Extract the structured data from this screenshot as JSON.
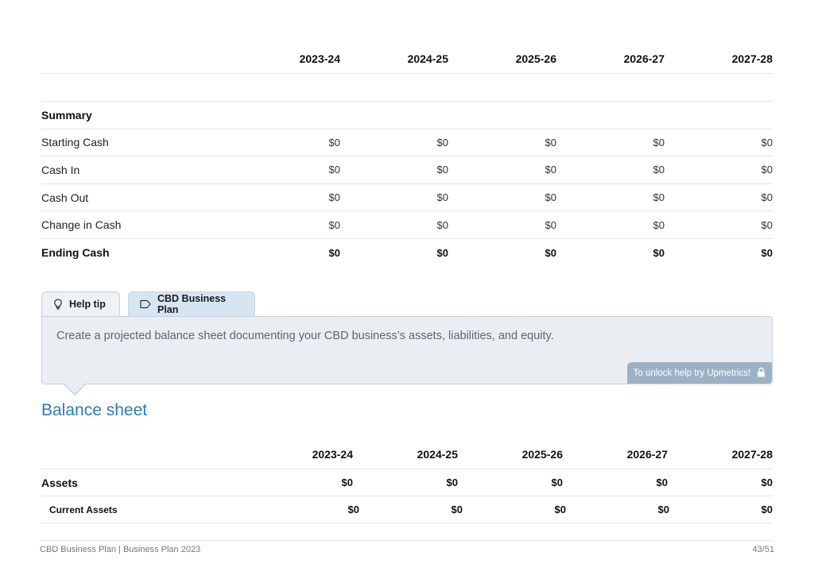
{
  "years": [
    "2023-24",
    "2024-25",
    "2025-26",
    "2026-27",
    "2027-28"
  ],
  "cashflow": {
    "summary_label": "Summary",
    "rows": [
      {
        "label": "Starting Cash",
        "values": [
          "$0",
          "$0",
          "$0",
          "$0",
          "$0"
        ]
      },
      {
        "label": "Cash In",
        "values": [
          "$0",
          "$0",
          "$0",
          "$0",
          "$0"
        ]
      },
      {
        "label": "Cash Out",
        "values": [
          "$0",
          "$0",
          "$0",
          "$0",
          "$0"
        ]
      },
      {
        "label": "Change in Cash",
        "values": [
          "$0",
          "$0",
          "$0",
          "$0",
          "$0"
        ]
      },
      {
        "label": "Ending Cash",
        "values": [
          "$0",
          "$0",
          "$0",
          "$0",
          "$0"
        ]
      }
    ]
  },
  "tabs": {
    "help_label": "Help tip",
    "plan_label": "CBD Business Plan"
  },
  "help": {
    "text": "Create a projected balance sheet documenting your CBD business’s assets, liabilities, and equity.",
    "unlock_label": "To unlock help try Upmetrics!"
  },
  "balance_sheet": {
    "title": "Balance sheet",
    "rows": [
      {
        "label": "Assets",
        "values": [
          "$0",
          "$0",
          "$0",
          "$0",
          "$0"
        ]
      },
      {
        "label": "Current Assets",
        "values": [
          "$0",
          "$0",
          "$0",
          "$0",
          "$0"
        ]
      }
    ]
  },
  "footer": {
    "left": "CBD Business Plan | Business Plan 2023",
    "right": "43/51"
  }
}
